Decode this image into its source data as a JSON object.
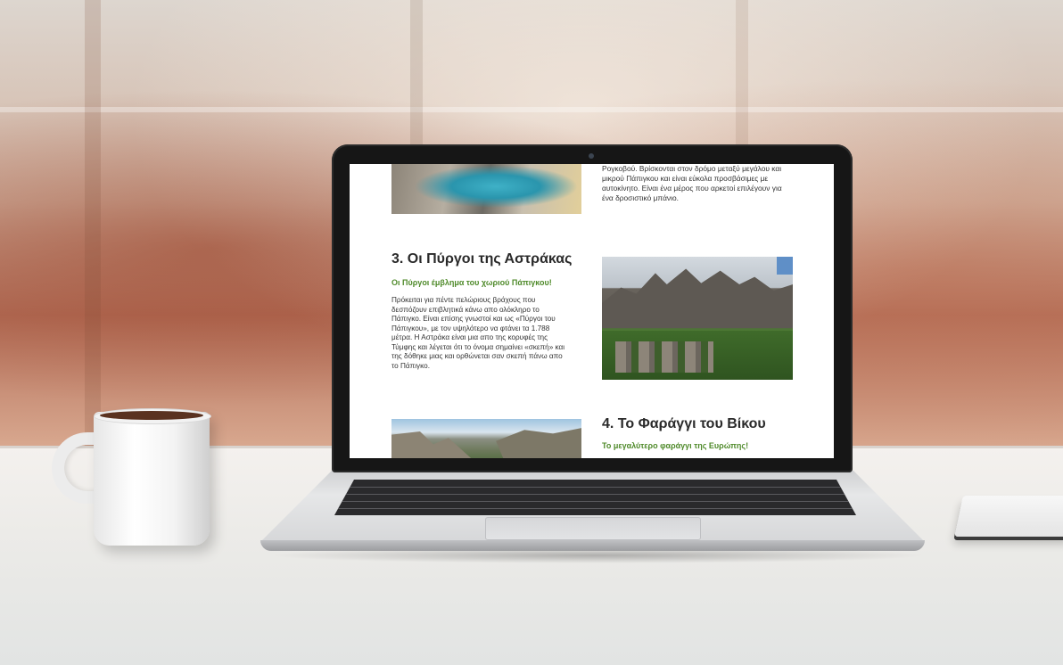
{
  "page": {
    "top_text": "Ρογκοβού. Βρίσκονται στον δρόμο μεταξύ μεγάλου και μικρού Πάπιγκου και είναι εύκολα προσβάσιμες με αυτοκίνητο. Είναι ένα μέρος που αρκετοί επιλέγουν για ένα δροσιστικό μπάνιο.",
    "sections": [
      {
        "title": "3. Οι Πύργοι της Αστράκας",
        "subtitle": "Οι Πύργοι έμβλημα του χωριού Πάπιγκου!",
        "body": "Πρόκειται για πέντε πελώριους βράχους που δεσπόζουν επιβλητικά κάνω απο ολόκληρο το Πάπιγκο. Είναι επίσης γνωστοί και ως «Πύργοι του Πάπιγκου», με τον υψηλότερο να φτάνει τα 1.788 μέτρα. Η Αστράκα είναι μια απο της κορυφές της Τύμφης και λέγεται ότι το όνομα σημαίνει «σκεπή» και της δόθηκε μιας και ορθώνεται σαν σκεπή πάνω απο το Πάπιγκο."
      },
      {
        "title": "4. Το Φαράγγι του Βίκου",
        "subtitle": "Το μεγαλύτερο φαράγγι της Ευρώπης!"
      }
    ]
  }
}
